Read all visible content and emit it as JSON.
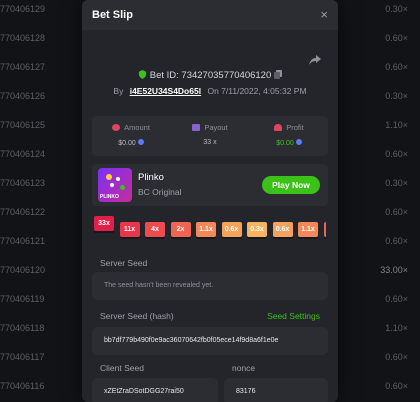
{
  "background": {
    "rows": [
      {
        "id": "770406129",
        "payout": "0.30×"
      },
      {
        "id": "770406128",
        "payout": "0.60×"
      },
      {
        "id": "770406127",
        "payout": "0.60×"
      },
      {
        "id": "770406126",
        "payout": "0.30×"
      },
      {
        "id": "770406125",
        "payout": "1.10×"
      },
      {
        "id": "770406124",
        "payout": "0.60×"
      },
      {
        "id": "770406123",
        "payout": "0.30×"
      },
      {
        "id": "770406122",
        "payout": "0.60×"
      },
      {
        "id": "770406121",
        "payout": "0.60×"
      },
      {
        "id": "770406120",
        "payout": "33.00×"
      },
      {
        "id": "770406119",
        "payout": "0.60×"
      },
      {
        "id": "770406118",
        "payout": "1.10×"
      },
      {
        "id": "770406117",
        "payout": "0.60×"
      },
      {
        "id": "770406116",
        "payout": "0.60×"
      }
    ]
  },
  "modal": {
    "title": "Bet Slip",
    "close": "×",
    "bet_id": "Bet ID: 7342703577040612​0",
    "by_label": "By",
    "user": "i4E52U34S4Do65l",
    "on_label": "On",
    "date": "7/11/2022, 4:05:32 PM"
  },
  "stats": {
    "amount": {
      "label": "Amount",
      "value": "$0.00"
    },
    "payout": {
      "label": "Payout",
      "value": "33 x"
    },
    "profit": {
      "label": "Profit",
      "value": "$0.00"
    }
  },
  "game": {
    "name": "Plinko",
    "sub": "BC Original",
    "thumb_label": "PLINKO",
    "play": "Play Now"
  },
  "multipliers": [
    {
      "label": "33x",
      "color": "#e21f48",
      "active": true
    },
    {
      "label": "11x",
      "color": "#e8364a"
    },
    {
      "label": "4x",
      "color": "#ed4c4e"
    },
    {
      "label": "2x",
      "color": "#f06552"
    },
    {
      "label": "1.1x",
      "color": "#f3885a"
    },
    {
      "label": "0.6x",
      "color": "#f5a35c"
    },
    {
      "label": "0.3x",
      "color": "#f7b45e"
    },
    {
      "label": "0.6x",
      "color": "#f5a35c"
    },
    {
      "label": "1.1x",
      "color": "#f3885a"
    },
    {
      "label": "",
      "color": "#f06552"
    }
  ],
  "server_seed": {
    "label": "Server Seed",
    "value": "The seed hasn't been revealed yet."
  },
  "server_hash": {
    "label": "Server Seed (hash)",
    "settings": "Seed Settings",
    "value": "bb7df779b490f0e9ac36070642fb0f05ece14f9d8a6f1e0e"
  },
  "client_seed": {
    "label": "Client Seed",
    "value": "xZEtZraDSotDGG27rai50"
  },
  "nonce": {
    "label": "nonce",
    "value": "83176"
  },
  "colors": {
    "accent_green": "#3bc117",
    "panel": "#23252b",
    "card": "#2b2d33"
  }
}
